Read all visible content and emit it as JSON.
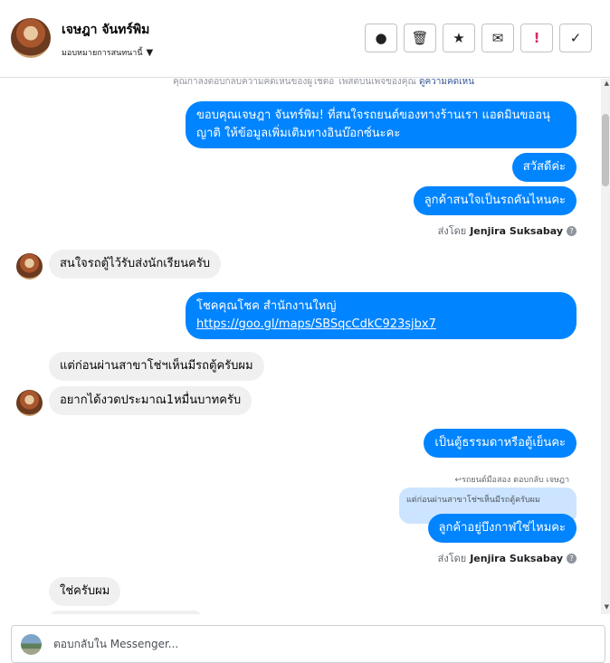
{
  "header": {
    "contact_name": "เจษฎา จันทร์พิม",
    "assign_label": "มอบหมายการสนทนานี้",
    "actions": [
      {
        "icon": "alert-circle-icon",
        "glyph": "●"
      },
      {
        "icon": "trash-icon",
        "glyph": "🗑"
      },
      {
        "icon": "star-icon",
        "glyph": "★"
      },
      {
        "icon": "envelope-icon",
        "glyph": "✉"
      },
      {
        "icon": "exclamation-icon",
        "glyph": "!"
      },
      {
        "icon": "check-icon",
        "glyph": "✓"
      }
    ]
  },
  "thread": {
    "notice_text": "คุณกำลังตอบกลับความคิดเห็นของผู้ใช้ต่อ โพสต์บนเพจของคุณ",
    "notice_link": "ดูความคิดเห็น",
    "messages": [
      {
        "dir": "out",
        "text": "ขอบคุณเจษฎา จันทร์พิม! ที่สนใจรถยนต์ของทางร้านเรา แอดมินขออนุญาติ ให้ข้อมูลเพิ่มเติมทางอินบ๊อกซ์นะคะ"
      },
      {
        "dir": "out",
        "text": "สวัสดีค่ะ"
      },
      {
        "dir": "out",
        "text": "ลูกค้าสนใจเป็นรถคันไหนคะ"
      },
      {
        "dir": "in",
        "text": "สนใจรถตู้ไว้รับส่งนักเรียนครับ"
      },
      {
        "dir": "out",
        "text": "โชคคุณโชค สำนักงานใหญ่",
        "link": "https://goo.gl/maps/SBSqcCdkC923sjbx7"
      },
      {
        "dir": "in",
        "text": "แต่ก่อนผ่านสาขาโช่ฯเห็นมีรถตู้ครับผม"
      },
      {
        "dir": "in",
        "text": "อยากได้งวดประมาณ1หมื่นบาทครับ"
      },
      {
        "dir": "out",
        "text": "เป็นตู้ธรรมดาหรือตู้เย็นคะ"
      },
      {
        "dir": "out",
        "text": "ลูกค้าอยู่บึงกาฬใช่ไหมคะ"
      },
      {
        "dir": "in",
        "text": "ใช่ครับผม"
      }
    ],
    "sent_by_prefix": "ส่งโดย",
    "sent_by_name": "Jenjira Suksabay",
    "reply_header": "↩รถยนต์มือสอง ตอบกลับ เจษฎา",
    "quoted_text": "แต่ก่อนผ่านสาขาโช่ฯเห็นมีรถตู้ครับผม"
  },
  "composer": {
    "placeholder": "ตอบกลับใน Messenger..."
  }
}
